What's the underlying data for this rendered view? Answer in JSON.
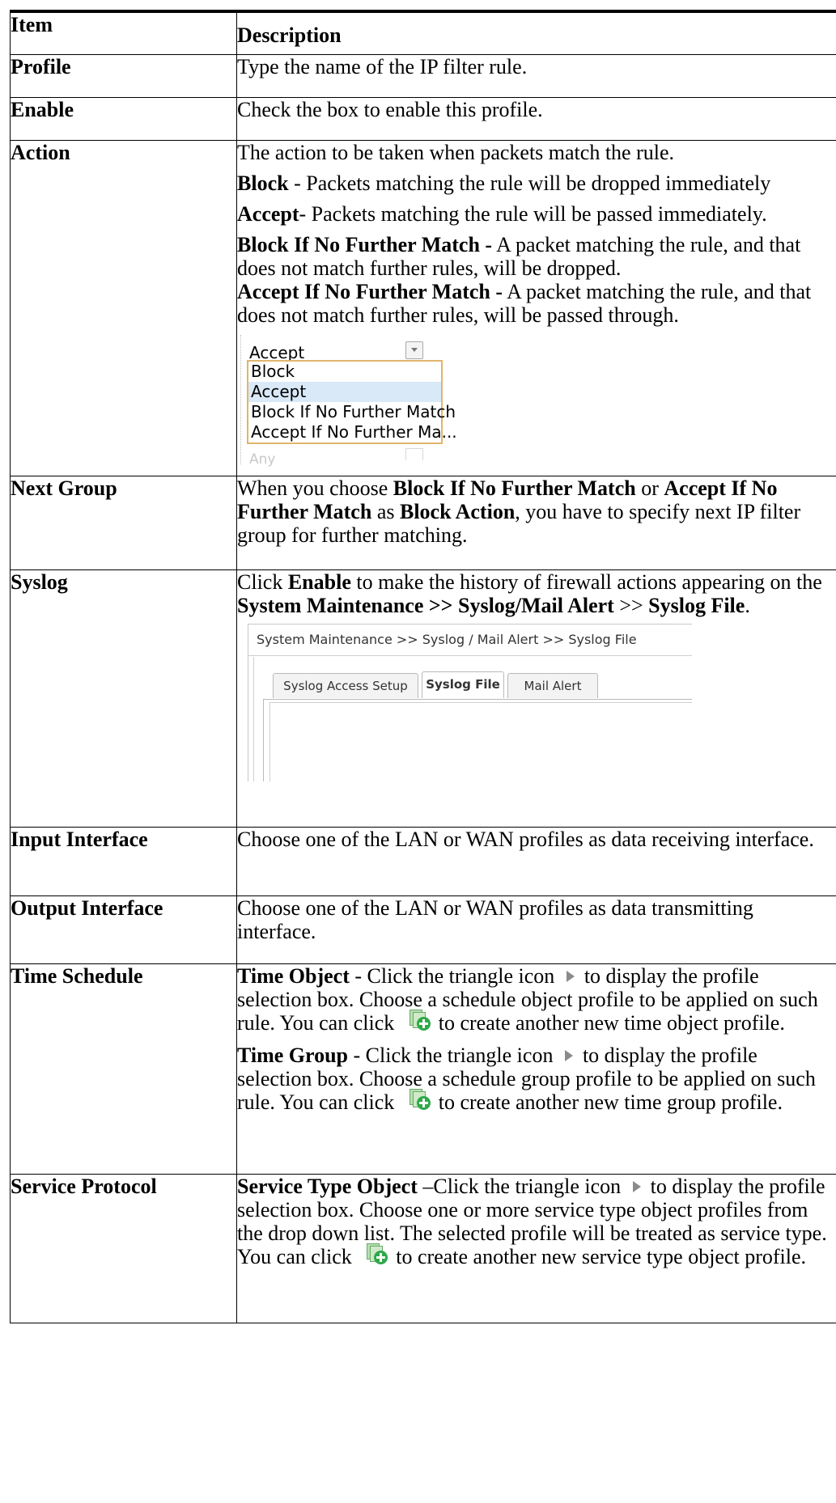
{
  "header": {
    "item": "Item",
    "description": "Description"
  },
  "rows": {
    "profile": {
      "item": "Profile",
      "desc": "Type the name of the IP filter rule."
    },
    "enable": {
      "item": "Enable",
      "desc": "Check the box to enable this profile."
    },
    "action": {
      "item": "Action",
      "intro": "The action to be taken when packets match the rule.",
      "block_label": "Block",
      "block_text": " - Packets matching the rule will be dropped immediately",
      "accept_label": "Accept",
      "accept_text": "- Packets matching the rule will be passed immediately.",
      "bifm_label": "Block If No Further Match -",
      "bifm_text": " A packet matching the rule, and that does not match further rules, will be dropped.",
      "aifm_label": "Accept If No Further Match -",
      "aifm_text": " A packet matching the rule, and that does not match further rules, will be passed through.",
      "dropdown": {
        "selected": "Accept",
        "options": [
          "Block",
          "Accept",
          "Block If No Further Match",
          "Accept If No Further Ma..."
        ],
        "ghost": "Any"
      }
    },
    "next_group": {
      "item": "Next Group",
      "t1": "When you choose ",
      "b1": "Block If No Further Match",
      "t2": " or ",
      "b2": "Accept If No Further Match",
      "t3": " as ",
      "b3": "Block Action",
      "t4": ", you have to specify next IP filter group for further matching."
    },
    "syslog": {
      "item": "Syslog",
      "t1": "Click ",
      "b1": "Enable",
      "t2": " to make the history of firewall actions appearing on the ",
      "b2": "System Maintenance >> Syslog/Mail Alert",
      "t3": " >> ",
      "b3": "Syslog File",
      "t4": ".",
      "screenshot": {
        "breadcrumb": "System Maintenance >> Syslog / Mail Alert >> Syslog File",
        "tabs": [
          "Syslog Access Setup",
          "Syslog File",
          "Mail Alert"
        ]
      }
    },
    "input_interface": {
      "item": "Input Interface",
      "desc": "Choose one of the LAN or WAN profiles as data receiving interface."
    },
    "output_interface": {
      "item": "Output Interface",
      "desc": "Choose one of the LAN or WAN profiles as data transmitting interface."
    },
    "time_schedule": {
      "item": "Time Schedule",
      "obj_label": "Time Object",
      "obj_t1": " - Click the triangle icon ",
      "obj_t2": "to display the profile selection box. Choose a schedule object profile to be applied on such rule. You can click ",
      "obj_t3": "to create another new time object profile.",
      "grp_label": "Time Group",
      "grp_t1": " - Click the triangle icon ",
      "grp_t2": "to display the profile selection box. Choose a schedule group profile to be applied on such rule. You can click ",
      "grp_t3": "to create another new time group profile."
    },
    "service_protocol": {
      "item": "Service Protocol",
      "label": "Service Type Object",
      "t1": " –Click the triangle icon ",
      "t2": "to display the profile selection box. Choose one or more service type object profiles from the drop down list. The selected profile will be treated as service type. You can click ",
      "t3": "to create another new service type object profile."
    }
  }
}
